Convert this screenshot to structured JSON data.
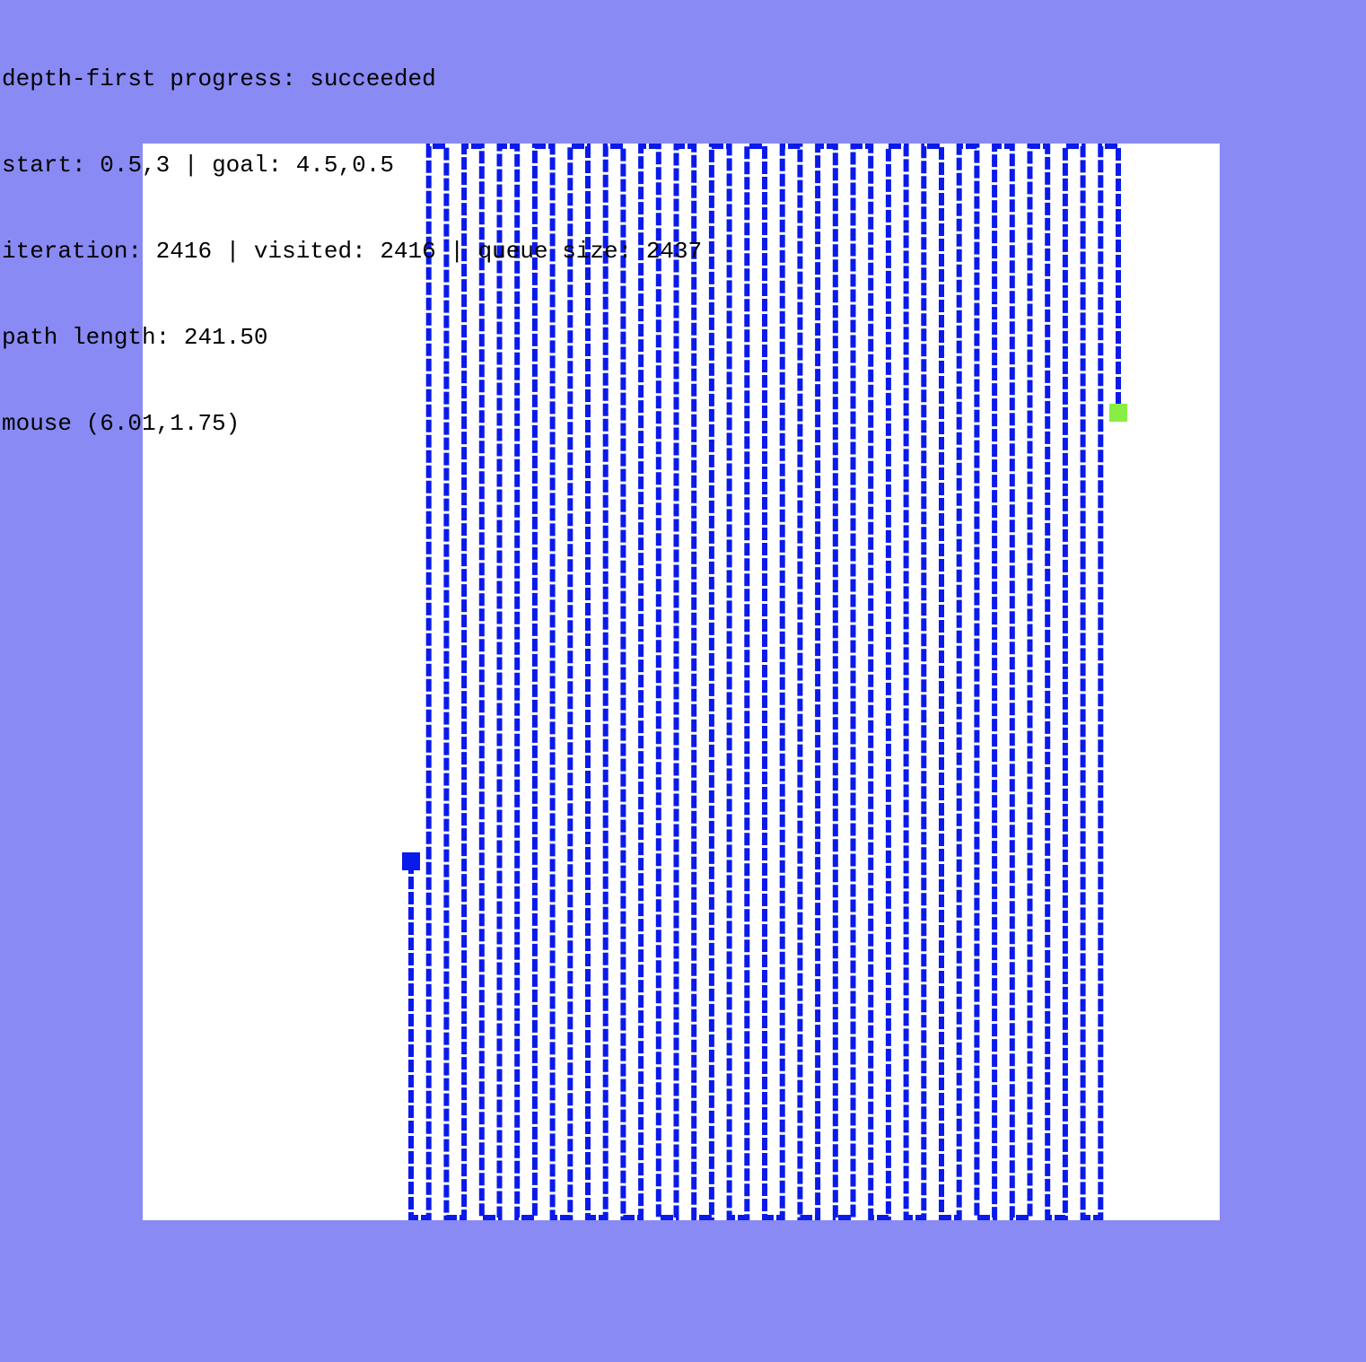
{
  "status": {
    "algorithm": "depth-first",
    "progress_label": "progress:",
    "progress": "succeeded",
    "start_label": "start:",
    "start": "0.5,3",
    "goal_label": "goal:",
    "goal": "4.5,0.5",
    "iteration_label": "iteration:",
    "iteration": "2416",
    "visited_label": "visited:",
    "visited": "2416",
    "queue_label": "queue size:",
    "queue_size": "2437",
    "path_length_label": "path length:",
    "path_length": "241.50",
    "mouse_label": "mouse",
    "mouse": "(6.01,1.75)",
    "separator": "|"
  },
  "colors": {
    "background": "#8a8af5",
    "canvas": "#ffffff",
    "path": "#0a1aeb",
    "start_marker": "#0a1aeb",
    "goal_marker": "#88ee44"
  },
  "maze": {
    "start": [
      0.5,
      3
    ],
    "goal": [
      4.5,
      0.5
    ]
  }
}
